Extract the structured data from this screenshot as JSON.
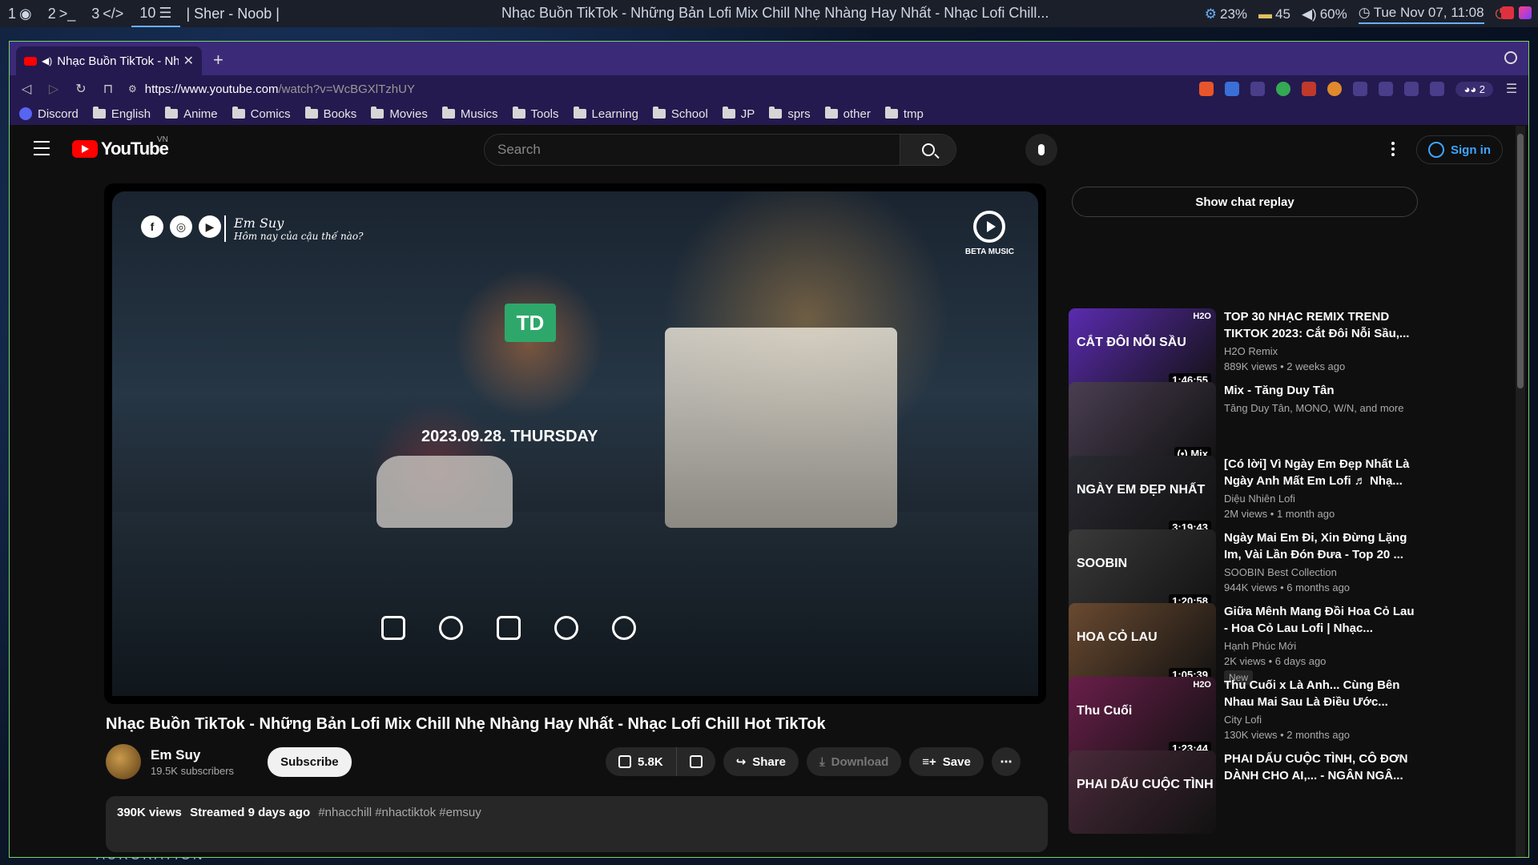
{
  "panel": {
    "workspaces": [
      "1",
      "2",
      "3",
      "10"
    ],
    "workspace_icons": [
      "firefox-icon",
      "terminal-icon",
      "code-icon",
      "chat-icon"
    ],
    "window_label": "| Sher - Noob |",
    "window_title": "Nhạc Buồn TikTok - Những Bản Lofi Mix Chill Nhẹ Nhàng Hay Nhất - Nhạc Lofi Chill...",
    "cpu": "23%",
    "battery": "45",
    "volume": "60%",
    "clock": "Tue Nov 07, 11:08"
  },
  "wallpaper_text": "AURORATION",
  "browser": {
    "tab_title": "Nhạc Buồn TikTok - Nh",
    "url_host": "https://www.youtube.com",
    "url_rest": "/watch?v=WcBGXlTzhUY",
    "profile_count": "2",
    "bookmarks": [
      "Discord",
      "English",
      "Anime",
      "Comics",
      "Books",
      "Movies",
      "Musics",
      "Tools",
      "Learning",
      "School",
      "JP",
      "sprs",
      "other",
      "tmp"
    ]
  },
  "youtube": {
    "logo_text": "YouTube",
    "country": "VN",
    "search_placeholder": "Search",
    "sign_in": "Sign in",
    "video": {
      "brand_name": "Em Suy",
      "brand_tagline": "Hôm nay của cậu thế nào?",
      "beta_label": "BETA MUSIC",
      "td_sign": "TD",
      "date_overlay": "2023.09.28. THURSDAY",
      "title": "Nhạc Buồn TikTok - Những Bản Lofi Mix Chill Nhẹ Nhàng Hay Nhất - Nhạc Lofi Chill Hot TikTok",
      "channel": "Em Suy",
      "subscribers": "19.5K subscribers",
      "subscribe": "Subscribe",
      "likes": "5.8K",
      "share": "Share",
      "download": "Download",
      "save": "Save",
      "views": "390K views",
      "streamed": "Streamed 9 days ago",
      "tags": "#nhacchill #nhactiktok #emsuy"
    },
    "chat_replay": "Show chat replay",
    "recommendations": [
      {
        "title": "TOP 30 NHẠC REMIX TREND TIKTOK 2023: Cắt Đôi Nỗi Sầu,...",
        "channel": "H2O Remix",
        "meta": "889K views • 2 weeks ago",
        "duration": "1:46:55",
        "thumb_text": "CẮT ĐÔI NỖI SẦU",
        "badge": "H2O",
        "color": "#5b2bb0",
        "new": ""
      },
      {
        "title": "Mix - Tăng Duy Tân",
        "channel": "Tăng Duy Tân, MONO, W/N, and more",
        "meta": "",
        "duration": "(•) Mix",
        "thumb_text": "",
        "badge": "",
        "color": "#4a3e52",
        "new": ""
      },
      {
        "title": "[Có lời] Vì Ngày Em Đẹp Nhất Là Ngày Anh Mất Em Lofi ♬ Nhạ...",
        "channel": "Diệu Nhiên Lofi",
        "meta": "2M views • 1 month ago",
        "duration": "3:19:43",
        "thumb_text": "NGÀY EM ĐẸP NHẤT",
        "badge": "",
        "color": "#2a2a32",
        "new": ""
      },
      {
        "title": "Ngày Mai Em Đi, Xin Đừng Lặng Im, Vài Lần Đón Đưa - Top 20 ...",
        "channel": "SOOBIN Best Collection",
        "meta": "944K views • 6 months ago",
        "duration": "1:20:58",
        "thumb_text": "SOOBIN",
        "badge": "",
        "color": "#3a3a3a",
        "new": ""
      },
      {
        "title": "Giữa Mênh Mang Đồi Hoa Cỏ Lau - Hoa Cỏ Lau Lofi | Nhạc...",
        "channel": "Hạnh Phúc Mới",
        "meta": "2K views • 6 days ago",
        "duration": "1:05:39",
        "thumb_text": "HOA CỎ LAU",
        "badge": "",
        "color": "#6a4a30",
        "new": "New"
      },
      {
        "title": "Thu Cuối x Là Anh... Cùng Bên Nhau Mai Sau Là Điều Ước...",
        "channel": "City Lofi",
        "meta": "130K views • 2 months ago",
        "duration": "1:23:44",
        "thumb_text": "Thu Cuối",
        "badge": "H2O",
        "color": "#6a1e4a",
        "new": ""
      },
      {
        "title": "PHAI DẤU CUỘC TÌNH, CÔ ĐƠN DÀNH CHO AI,... - NGÂN NGÂ...",
        "channel": "",
        "meta": "",
        "duration": "",
        "thumb_text": "PHAI DẤU CUỘC TÌNH",
        "badge": "",
        "color": "#4a2a3a",
        "new": ""
      }
    ]
  }
}
